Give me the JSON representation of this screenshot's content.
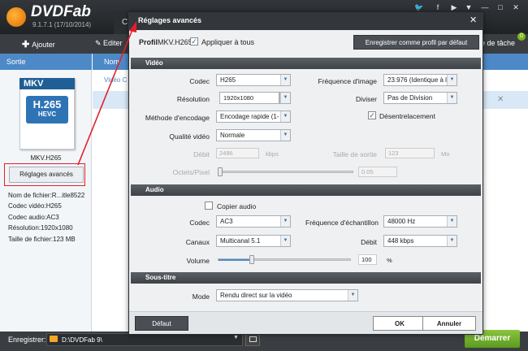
{
  "app": {
    "name": "DVDFab",
    "version": "9.1.7.1 (17/10/2014)",
    "tab_label": "C"
  },
  "top_icons": [
    "twitter-icon",
    "facebook-icon",
    "youtube-icon",
    "menu-icon",
    "minimize-icon",
    "maximize-icon",
    "close-icon"
  ],
  "toolbar": {
    "add_label": "Ajouter",
    "edit_label": "Editer",
    "task_label": "e de tâche",
    "badge": "0"
  },
  "sidebar": {
    "header": "Sortie",
    "profile_badge": "MKV",
    "codec_badge": "H.265",
    "codec_badge_sub": "HEVC",
    "profile_name": "MKV.H265",
    "advanced_button": "Réglages avancés",
    "info": [
      "Nom de fichier:R...itle8522",
      "Codec vidéo:H265",
      "Codec audio:AC3",
      "Résolution:1920x1080",
      "Taille de fichier:123 MB"
    ]
  },
  "main": {
    "header": "Nom",
    "row_label": "Vidéo C"
  },
  "bottom": {
    "save_label": "Enregistrer:",
    "path": "D:\\DVDFab 9\\",
    "start_label": "Démarrer"
  },
  "dialog": {
    "title": "Réglages avancés",
    "profile_label": "Profil",
    "profile_value": "MKV.H265",
    "apply_all_label": "Appliquer à tous",
    "save_profile_label": "Enregistrer comme profil par défaut",
    "video_section": "Vidéo",
    "video": {
      "codec_label": "Codec",
      "codec_value": "H265",
      "framerate_label": "Fréquence d'image",
      "framerate_value": "23.976 (Identique à l",
      "resolution_label": "Résolution",
      "resolution_value": "1920x1080",
      "divide_label": "Diviser",
      "divide_value": "Pas de Division",
      "encoding_label": "Méthode d'encodage",
      "encoding_value": "Encodage rapide (1-",
      "deinterlace_label": "Désentrelacement",
      "quality_label": "Qualité vidéo",
      "quality_value": "Normale",
      "bitrate_label": "Débit",
      "bitrate_value": "2486",
      "bitrate_unit": "kbps",
      "outsize_label": "Taille de sortie",
      "outsize_value": "123",
      "outsize_unit": "Mo",
      "octets_label": "Octets/Pixel",
      "octets_value": "0.05"
    },
    "audio_section": "Audio",
    "audio": {
      "copy_label": "Copier audio",
      "codec_label": "Codec",
      "codec_value": "AC3",
      "samplerate_label": "Fréquence d'échantillon",
      "samplerate_value": "48000 Hz",
      "channels_label": "Canaux",
      "channels_value": "Multicanal 5.1",
      "bitrate_label": "Débit",
      "bitrate_value": "448 kbps",
      "volume_label": "Volume",
      "volume_value": "100",
      "volume_unit": "%",
      "volume_level": 0.25
    },
    "subtitle_section": "Sous-titre",
    "subtitle": {
      "mode_label": "Mode",
      "mode_value": "Rendu direct sur la vidéo"
    },
    "default_button": "Défaut",
    "ok_button": "OK",
    "cancel_button": "Annuler"
  },
  "colors": {
    "accent": "#4d89c6",
    "start": "#6fae2a",
    "highlight": "#e0202a"
  }
}
